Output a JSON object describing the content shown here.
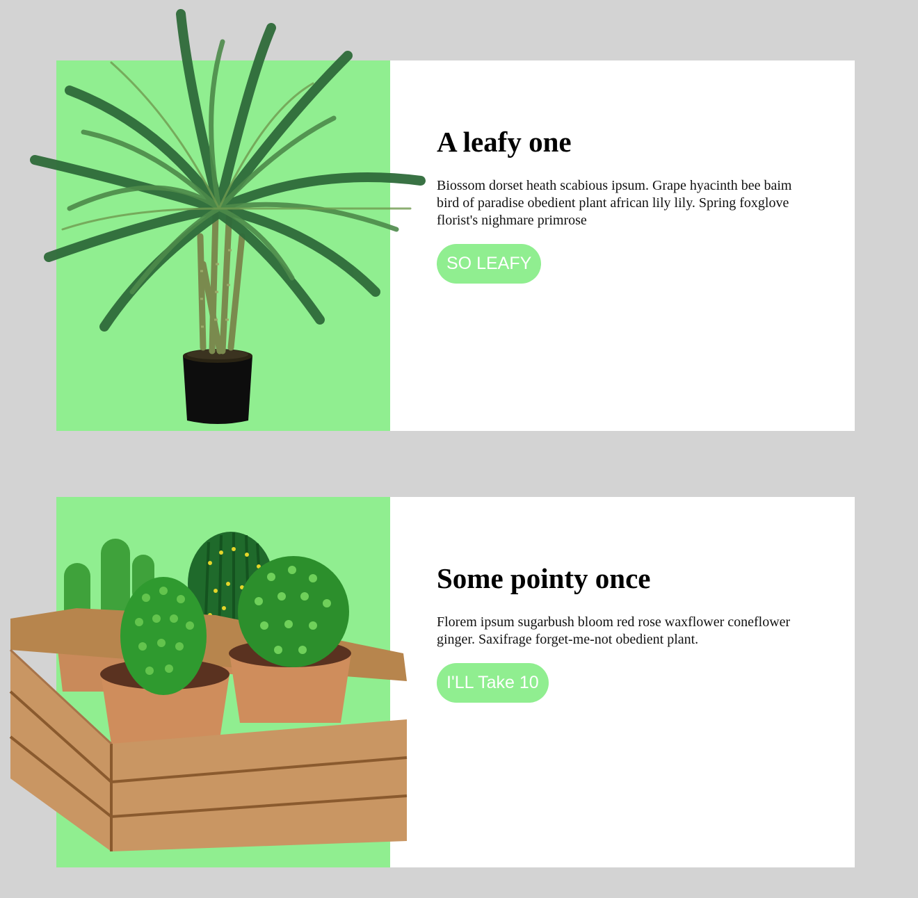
{
  "cards": [
    {
      "title": "A leafy one",
      "text": "Biossom dorset heath scabious ipsum. Grape hyacinth bee baim bird of paradise obedient plant african lily lily. Spring foxglove florist's nighmare primrose",
      "button": "SO LEAFY",
      "image": "potted-palm"
    },
    {
      "title": "Some pointy once",
      "text": "Florem ipsum sugarbush bloom red rose waxflower coneflower ginger. Saxifrage forget-me-not obedient plant.",
      "button": "I'LL Take 10",
      "image": "cacti-in-wooden-crate"
    }
  ],
  "colors": {
    "page_background": "#d3d3d3",
    "card_background": "#ffffff",
    "accent_green": "#90ee90",
    "button_text": "#ffffff"
  }
}
